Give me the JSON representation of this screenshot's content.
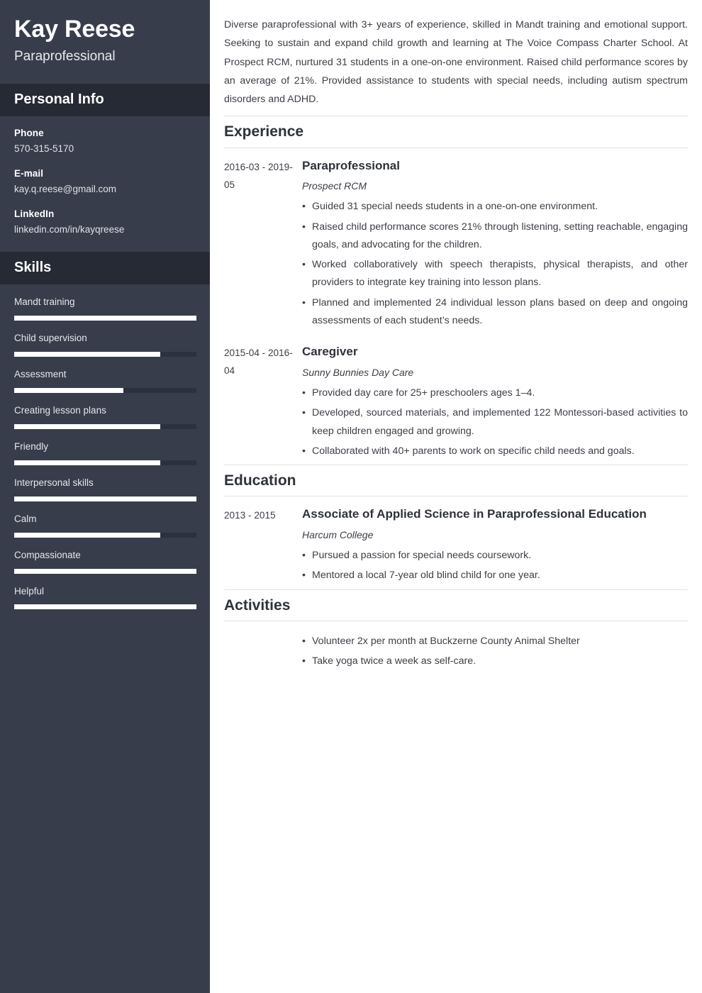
{
  "theme": {
    "sidebar_bg": "#373d4b",
    "sidebar_band_bg": "#252a35",
    "skill_track": "#2b313d",
    "skill_fill": "#ffffff",
    "main_bg": "#ffffff",
    "text_dark": "#3b3f46",
    "heading_dark": "#2e3239",
    "rule": "#e2e2e2"
  },
  "sidebar": {
    "name": "Kay Reese",
    "job_title": "Paraprofessional",
    "personal_info_heading": "Personal Info",
    "contacts": [
      {
        "label": "Phone",
        "value": "570-315-5170"
      },
      {
        "label": "E-mail",
        "value": "kay.q.reese@gmail.com"
      },
      {
        "label": "LinkedIn",
        "value": "linkedin.com/in/kayqreese"
      }
    ],
    "skills_heading": "Skills",
    "skills": [
      {
        "name": "Mandt training",
        "level": 100
      },
      {
        "name": "Child supervision",
        "level": 80
      },
      {
        "name": "Assessment",
        "level": 60
      },
      {
        "name": "Creating lesson plans",
        "level": 80
      },
      {
        "name": "Friendly",
        "level": 80
      },
      {
        "name": "Interpersonal skills",
        "level": 100
      },
      {
        "name": "Calm",
        "level": 80
      },
      {
        "name": "Compassionate",
        "level": 100
      },
      {
        "name": "Helpful",
        "level": 100
      }
    ]
  },
  "main": {
    "summary": "Diverse paraprofessional with 3+ years of experience, skilled in Mandt training and emotional support. Seeking to sustain and expand child growth and learning at The Voice Compass Charter School. At Prospect RCM, nurtured 31 students in a one-on-one environment. Raised child performance scores by an average of 21%. Provided assistance to students with special needs, including autism spectrum disorders and ADHD.",
    "experience": {
      "heading": "Experience",
      "entries": [
        {
          "dates": "2016-03 - 2019-05",
          "role": "Paraprofessional",
          "org": "Prospect RCM",
          "bullets": [
            "Guided 31 special needs students in a one-on-one environment.",
            "Raised child performance scores 21% through listening, setting reachable, engaging goals, and advocating for the children.",
            "Worked collaboratively with speech therapists, physical therapists, and other providers to integrate key training into lesson plans.",
            "Planned and implemented 24 individual lesson plans based on deep and ongoing assessments of each student’s needs."
          ]
        },
        {
          "dates": "2015-04 - 2016-04",
          "role": "Caregiver",
          "org": "Sunny Bunnies Day Care",
          "bullets": [
            "Provided day care for 25+ preschoolers ages 1–4.",
            "Developed, sourced materials, and implemented 122 Montessori-based activities to keep children engaged and growing.",
            "Collaborated with 40+ parents to work on specific child needs and goals."
          ]
        }
      ]
    },
    "education": {
      "heading": "Education",
      "entries": [
        {
          "dates": "2013 - 2015",
          "degree": "Associate of Applied Science in Paraprofessional Education",
          "school": "Harcum College",
          "bullets": [
            "Pursued a passion for special needs coursework.",
            "Mentored a local 7-year old blind child for one year."
          ]
        }
      ]
    },
    "activities": {
      "heading": "Activities",
      "bullets": [
        "Volunteer 2x per month at Buckzerne County Animal Shelter",
        "Take yoga twice a week as self-care."
      ]
    }
  }
}
